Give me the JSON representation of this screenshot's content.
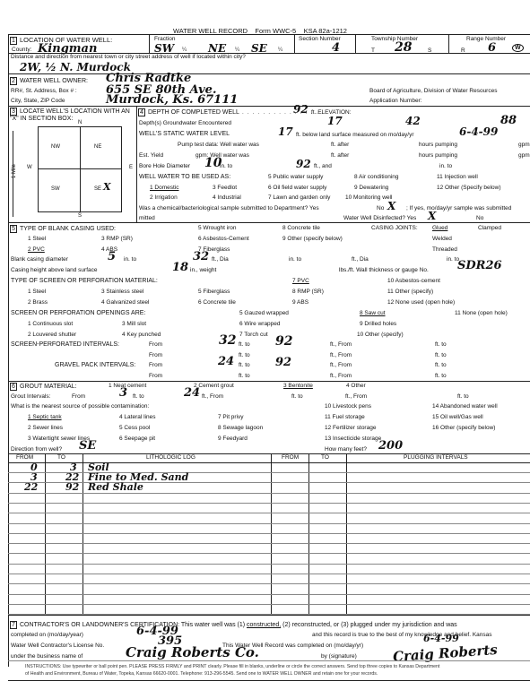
{
  "header": {
    "title": "WATER WELL RECORD",
    "form": "Form WWC-5",
    "statute": "KSA 82a-1212"
  },
  "section1": {
    "number": "1",
    "title": "LOCATION OF WATER WELL:",
    "county_label": "County:",
    "county": "Kingman",
    "fraction_label": "Fraction",
    "fraction": [
      "SW",
      "NE",
      "SE"
    ],
    "quarter_mark": "¼",
    "section_number_label": "Section Number",
    "section_number": "4",
    "township_label": "Township Number",
    "township_prefix": "T",
    "township": "28",
    "township_suffix": "S",
    "range_label": "Range Number",
    "range_prefix": "R",
    "range": "6",
    "range_dir": "W",
    "range_dir_selected": "W",
    "distance_label": "Distance and direction from nearest town or city street address of well if located within city?",
    "distance": "2W, ½ N. Murdock"
  },
  "section2": {
    "number": "2",
    "title": "WATER WELL OWNER:",
    "owner": "Chris Radtke",
    "address_label": "RR#, St. Address, Box # :",
    "address": "655 SE 80th Ave.",
    "city_label": "City, State, ZIP Code",
    "city": "Murdock, Ks. 67111",
    "board": "Board of Agriculture, Division of Water Resources",
    "application_label": "Application Number:"
  },
  "section3": {
    "number": "3",
    "title": "LOCATE WELL'S LOCATION WITH AN \"X\" IN SECTION BOX:",
    "compass": {
      "n": "N",
      "s": "S",
      "e": "E",
      "w": "W"
    },
    "mile_label": "1 Mile",
    "quadrants": [
      "NW",
      "NE",
      "SW",
      "SE"
    ],
    "marked_quadrant": "SE",
    "mark": "X"
  },
  "section4": {
    "number": "4",
    "depth_label": "DEPTH OF COMPLETED WELL",
    "depth": "92",
    "elevation_label": "ft. ELEVATION:",
    "groundwater_label": "Depth(s) Groundwater Encountered",
    "groundwater": [
      "17",
      "42",
      "88"
    ],
    "static_label": "WELL'S STATIC WATER LEVEL",
    "static_level": "17",
    "static_suffix": "ft. below land surface measured on mo/day/yr",
    "static_date": "6-4-99",
    "pump_label": "Pump test data:  Well water was",
    "ft_after": "ft. after",
    "hours_pumping": "hours pumping",
    "gpm": "gpm",
    "yield_label": "Est. Yield",
    "yield_gpm": "gpm:  Well water was",
    "bore_label": "Bore Hole Diameter",
    "bore_diameter": "10",
    "bore_in_to": "in. to",
    "bore_depth": "92",
    "bore_ft_and": "ft., and",
    "in_to": "in. to",
    "ft": "ft.",
    "use_label": "WELL WATER TO BE USED AS:",
    "uses": [
      "1 Domestic",
      "3 Feedlot",
      "5 Public water supply",
      "8 Air conditioning",
      "11 Injection well",
      "2 Irrigation",
      "4 Industrial",
      "6 Oil field water supply",
      "9 Dewatering",
      "12 Other (Specify below)",
      "7 Lawn and garden only",
      "10 Monitoring well"
    ],
    "selected_use": "1 Domestic",
    "sample_label": "Was a chemical/bacteriological sample submitted to Department? Yes",
    "sample_no": "No",
    "sample_answer": "X",
    "sample_date_label": "; If yes, mo/day/yr sample was submitted",
    "mitted": "mitted",
    "disinfected_label": "Water Well Disinfected?  Yes",
    "disinfected_answer": "X",
    "disinfected_no": "No"
  },
  "section5": {
    "number": "5",
    "casing_title": "TYPE OF BLANK CASING USED:",
    "casing_types": [
      "1 Steel",
      "3 RMP (SR)",
      "5 Wrought iron",
      "8 Concrete tile",
      "2 PVC",
      "4 ABS",
      "6 Asbestos-Cement",
      "9 Other (specify below)",
      "7 Fiberglass"
    ],
    "selected_casing": "2 PVC",
    "joints_label": "CASING JOINTS:",
    "joints": [
      "Glued",
      "Clamped",
      "Welded",
      "Threaded"
    ],
    "selected_joint": "Glued",
    "blank_diameter_label": "Blank casing diameter",
    "blank_diameter": "5",
    "blank_to": "in. to",
    "blank_depth": "32",
    "dia": "ft., Dia",
    "height_label": "Casing height above land surface",
    "height": "18",
    "weight_label": "in., weight",
    "lbs_label": "lbs./ft. Wall thickness or gauge No.",
    "gauge": "SDR26",
    "screen_title": "TYPE OF SCREEN OR PERFORATION MATERIAL:",
    "screen_types": [
      "1 Steel",
      "3 Stainless steel",
      "5 Fiberglass",
      "7 PVC",
      "10 Asbestos-cement",
      "2 Brass",
      "4 Galvanized steel",
      "6 Concrete tile",
      "8 RMP (SR)",
      "11 Other (specify)",
      "9 ABS",
      "12 None used (open hole)"
    ],
    "selected_screen": "7 PVC",
    "openings_title": "SCREEN OR PERFORATION OPENINGS ARE:",
    "openings": [
      "1 Continuous slot",
      "3 Mill slot",
      "5 Gauzed wrapped",
      "8 Saw cut",
      "11 None (open hole)",
      "2 Louvered shutter",
      "4 Key punched",
      "6 Wire wrapped",
      "9 Drilled holes",
      "7 Torch cut",
      "10 Other (specify)"
    ],
    "selected_opening": "8 Saw cut",
    "screen_intervals_label": "SCREEN-PERFORATED INTERVALS:",
    "screen_from": "32",
    "screen_to": "92",
    "gravel_label": "GRAVEL PACK INTERVALS:",
    "gravel_from": "24",
    "gravel_to": "92",
    "from": "From",
    "ft_to": "ft. to",
    "ft_from": "ft., From"
  },
  "section6": {
    "number": "6",
    "grout_title": "GROUT MATERIAL:",
    "grout_types": [
      "1 Neat cement",
      "2 Cement grout",
      "3 Bentonite",
      "4 Other"
    ],
    "selected_grout": "3 Bentonite",
    "grout_intervals_label": "Grout Intervals:",
    "grout_from": "3",
    "grout_to": "24",
    "contamination_label": "What is the nearest source of possible contamination:",
    "sources": [
      "1 Septic tank",
      "4 Lateral lines",
      "7 Pit privy",
      "10 Livestock pens",
      "14 Abandoned water well",
      "2 Sewer lines",
      "5 Cess pool",
      "8 Sewage lagoon",
      "11 Fuel storage",
      "15 Oil well/Gas well",
      "3 Watertight sewer lines",
      "6 Seepage pit",
      "9 Feedyard",
      "12 Fertilizer storage",
      "16 Other (specify below)",
      "13 Insecticide storage"
    ],
    "selected_source": "1 Septic tank",
    "direction_label": "Direction from well?",
    "direction": "SE",
    "feet_label": "How many feet?",
    "feet": "200"
  },
  "log": {
    "headers": [
      "FROM",
      "TO",
      "LITHOLOGIC LOG",
      "FROM",
      "TO",
      "PLUGGING INTERVALS"
    ],
    "rows": [
      {
        "from": "0",
        "to": "3",
        "desc": "Soil"
      },
      {
        "from": "3",
        "to": "22",
        "desc": "Fine to Med. Sand"
      },
      {
        "from": "22",
        "to": "92",
        "desc": "Red Shale"
      }
    ]
  },
  "section7": {
    "number": "7",
    "cert_text": "CONTRACTOR'S OR LANDOWNER'S CERTIFICATION: This water well was (1)",
    "constructed": "constructed,",
    "cert_text2": "(2) reconstructed, or (3) plugged under my jurisdiction and was",
    "completed_label": "completed on (mo/day/year)",
    "completed_date": "6-4-99",
    "true_text": "and this record is true to the best of my knowledge and belief. Kansas",
    "license_label": "Water Well Contractor's License No.",
    "license": "395",
    "record_completed_label": "This Water Well Record was completed on (mo/day/yr)",
    "record_completed_date": "6-4-99",
    "business_label": "under the business name of",
    "business": "Craig Roberts Co.",
    "signature_label": "by (signature)",
    "signature": "Craig Roberts",
    "instructions": "INSTRUCTIONS: Use typewriter or ball point pen. PLEASE PRESS FIRMLY and PRINT clearly. Please fill in blanks, underline or circle the correct answers. Send top three copies to Kansas Department",
    "instructions2": "of Health and Environment, Bureau of Water, Topeka, Kansas 66620-0001. Telephone: 913-296-5545. Send one to WATER WELL OWNER and retain one for your records."
  }
}
